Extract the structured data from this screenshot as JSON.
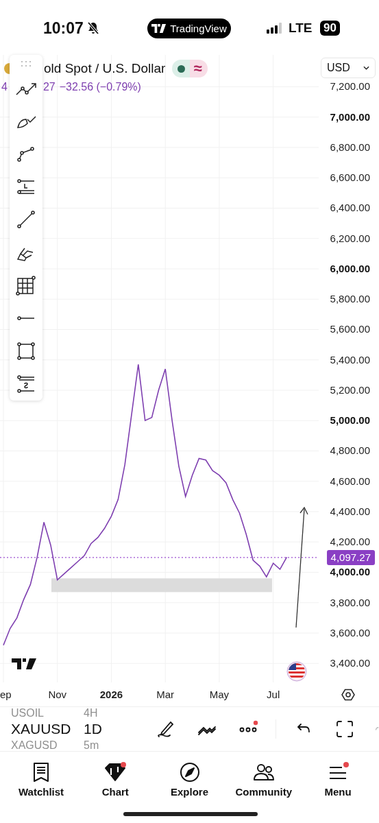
{
  "status_bar": {
    "time": "10:07",
    "app_pill": "TradingView",
    "network": "LTE",
    "battery": "90"
  },
  "header": {
    "symbol_title": "old Spot / U.S. Dollar",
    "price_fragment": "4",
    "price_rest": "27",
    "change": "−32.56 (−0.79%)",
    "delayed_mark": "≈",
    "currency": "USD"
  },
  "chart": {
    "chart_data": {
      "type": "line",
      "ylim": [
        3270,
        7410
      ],
      "categories": [
        "ep",
        null,
        null,
        null,
        null,
        null,
        null,
        null,
        "Nov",
        null,
        null,
        null,
        null,
        null,
        null,
        null,
        "2026",
        null,
        null,
        null,
        null,
        null,
        null,
        null,
        "Mar",
        null,
        null,
        null,
        null,
        null,
        null,
        null,
        "May",
        null,
        null,
        null,
        null,
        null,
        null,
        null,
        "Jul",
        null,
        null
      ],
      "series": [
        {
          "color": "#7e3fb0",
          "values": [
            3520,
            3630,
            3700,
            3820,
            3920,
            4100,
            4330,
            4180,
            3950,
            3990,
            4030,
            4070,
            4110,
            4190,
            4230,
            4290,
            4370,
            4480,
            4710,
            5040,
            5370,
            5000,
            5020,
            5200,
            5340,
            5000,
            4700,
            4500,
            4640,
            4750,
            4740,
            4670,
            4640,
            4590,
            4480,
            4390,
            4250,
            4080,
            4040,
            3970,
            4060,
            4020,
            4100
          ]
        }
      ],
      "yticks": [
        {
          "value": 3400,
          "label": "3,400.00"
        },
        {
          "value": 3600,
          "label": "3,600.00"
        },
        {
          "value": 3800,
          "label": "3,800.00"
        },
        {
          "value": 4000,
          "label": "4,000.00"
        },
        {
          "value": 4200,
          "label": "4,200.00"
        },
        {
          "value": 4400,
          "label": "4,400.00"
        },
        {
          "value": 4600,
          "label": "4,600.00"
        },
        {
          "value": 4800,
          "label": "4,800.00"
        },
        {
          "value": 5000,
          "label": "5,000.00"
        },
        {
          "value": 5200,
          "label": "5,200.00"
        },
        {
          "value": 5400,
          "label": "5,400.00"
        },
        {
          "value": 5600,
          "label": "5,600.00"
        },
        {
          "value": 5800,
          "label": "5,800.00"
        },
        {
          "value": 6000,
          "label": "6,000.00"
        },
        {
          "value": 6200,
          "label": "6,200.00"
        },
        {
          "value": 6400,
          "label": "6,400.00"
        },
        {
          "value": 6600,
          "label": "6,600.00"
        },
        {
          "value": 6800,
          "label": "6,800.00"
        },
        {
          "value": 7000,
          "label": "7,000.00"
        },
        {
          "value": 7200,
          "label": "7,200.00"
        }
      ],
      "grid": true,
      "ref_lines": [
        {
          "axis": "y",
          "value": 4097.27,
          "label": "4,097.27"
        }
      ]
    }
  },
  "symbol_wheel": [
    {
      "symbol": "USOIL",
      "interval": "4H",
      "selected": false
    },
    {
      "symbol": "XAUUSD",
      "interval": "1D",
      "selected": true
    },
    {
      "symbol": "XAGUSD",
      "interval": "5m",
      "selected": false
    }
  ],
  "chart_tools": [
    {
      "kind": "draw",
      "badge": false
    },
    {
      "kind": "indicators",
      "badge": false
    },
    {
      "kind": "more",
      "badge": true
    },
    {
      "kind": "undo",
      "badge": false
    },
    {
      "kind": "fullscreen",
      "badge": false
    }
  ],
  "tabs": [
    {
      "kind": "watchlist",
      "label": "Watchlist",
      "selected": false,
      "badge": false
    },
    {
      "kind": "chart",
      "label": "Chart",
      "selected": true,
      "badge": true
    },
    {
      "kind": "explore",
      "label": "Explore",
      "selected": false,
      "badge": false
    },
    {
      "kind": "community",
      "label": "Community",
      "selected": false,
      "badge": false
    },
    {
      "kind": "menu",
      "label": "Menu",
      "selected": false,
      "badge": true
    }
  ]
}
